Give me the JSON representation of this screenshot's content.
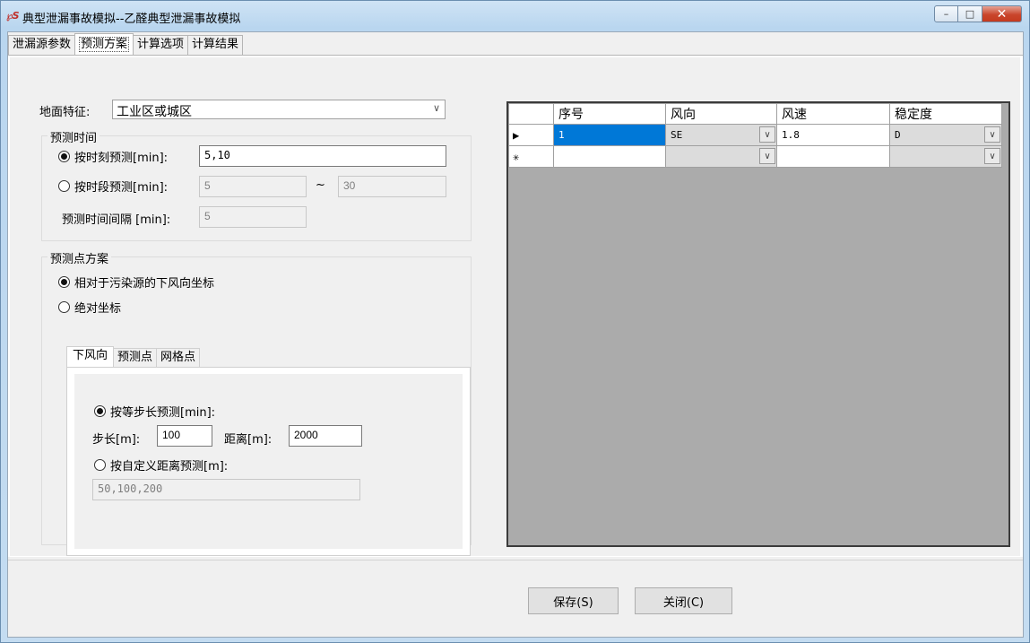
{
  "window": {
    "icon_text": "℘S",
    "title": "典型泄漏事故模拟--乙醛典型泄漏事故模拟",
    "min_glyph": "–",
    "max_glyph": "□",
    "close_glyph": "✕"
  },
  "tabs": [
    "泄漏源参数",
    "预测方案",
    "计算选项",
    "计算结果"
  ],
  "active_tab": 1,
  "ground": {
    "label": "地面特征:",
    "value": "工业区或城区"
  },
  "predict_time": {
    "group_title": "预测时间",
    "by_moment_label": "按时刻预测[min]:",
    "by_moment_value": "5,10",
    "by_period_label": "按时段预测[min]:",
    "period_from": "5",
    "tilde": "~",
    "period_to": "30",
    "interval_label": "预测时间间隔 [min]:",
    "interval_value": "5"
  },
  "predict_point": {
    "group_title": "预测点方案",
    "relative_label": "相对于污染源的下风向坐标",
    "absolute_label": "绝对坐标",
    "subtabs": [
      "下风向",
      "预测点",
      "网格点"
    ],
    "equal_step_label": "按等步长预测[min]:",
    "step_label": "步长[m]:",
    "step_value": "100",
    "distance_label": "距离[m]:",
    "distance_value": "2000",
    "custom_label": "按自定义距离预测[m]:",
    "custom_value": "50,100,200"
  },
  "grid": {
    "columns": [
      "序号",
      "风向",
      "风速",
      "稳定度"
    ],
    "rows": [
      {
        "marker": "▶",
        "seq": "1",
        "dir": "SE",
        "speed": "1.8",
        "stability": "D"
      },
      {
        "marker": "✳",
        "seq": "",
        "dir": "",
        "speed": "",
        "stability": ""
      }
    ],
    "dropdown_glyph": "∨"
  },
  "buttons": {
    "save": "保存(S)",
    "close": "关闭(C)"
  }
}
